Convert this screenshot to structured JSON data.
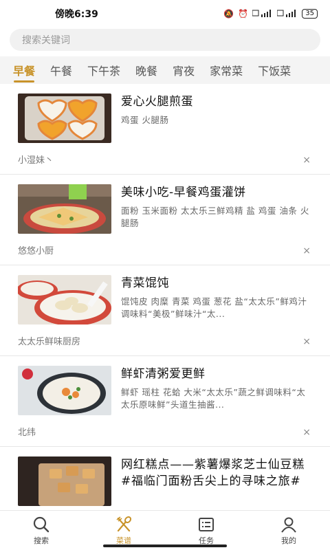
{
  "status": {
    "time": "傍晚6:39",
    "battery": "35"
  },
  "search": {
    "placeholder": "搜索关键词"
  },
  "tabs": [
    "早餐",
    "午餐",
    "下午茶",
    "晚餐",
    "宵夜",
    "家常菜",
    "下饭菜"
  ],
  "active_tab": "早餐",
  "recipes": [
    {
      "title": "爱心火腿煎蛋",
      "ingredients": "鸡蛋 火腿肠",
      "author": "小湿妹丶"
    },
    {
      "title": "美味小吃-早餐鸡蛋灌饼",
      "ingredients": "面粉 玉米面粉 太太乐三鲜鸡精 盐 鸡蛋 油条 火腿肠",
      "author": "悠悠小厨"
    },
    {
      "title": "青菜馄饨",
      "ingredients": "馄饨皮 肉糜 青菜 鸡蛋 葱花 盐“太太乐”鲜鸡汁调味料“美极”鲜味汁“太...",
      "author": "太太乐鲜味厨房"
    },
    {
      "title": "鲜虾清粥爱更鲜",
      "ingredients": "鲜虾 瑶柱 花蛤 大米“太太乐”蔬之鲜调味料“太太乐原味鲜”头道生抽酱...",
      "author": "北纬"
    },
    {
      "title": "网红糕点——紫薯爆浆芝士仙豆糕#福临门面粉舌尖上的寻味之旅#",
      "ingredients": "",
      "author": ""
    }
  ],
  "close_symbol": "×",
  "bottom_nav": [
    {
      "label": "搜索",
      "icon": "search-icon"
    },
    {
      "label": "菜谱",
      "icon": "fork-spoon-icon"
    },
    {
      "label": "任务",
      "icon": "task-list-icon"
    },
    {
      "label": "我的",
      "icon": "person-icon"
    }
  ],
  "active_nav": "菜谱",
  "colors": {
    "accent": "#c8932a",
    "tab_bg": "#f4f4f4",
    "divider": "#e6e6e6"
  }
}
